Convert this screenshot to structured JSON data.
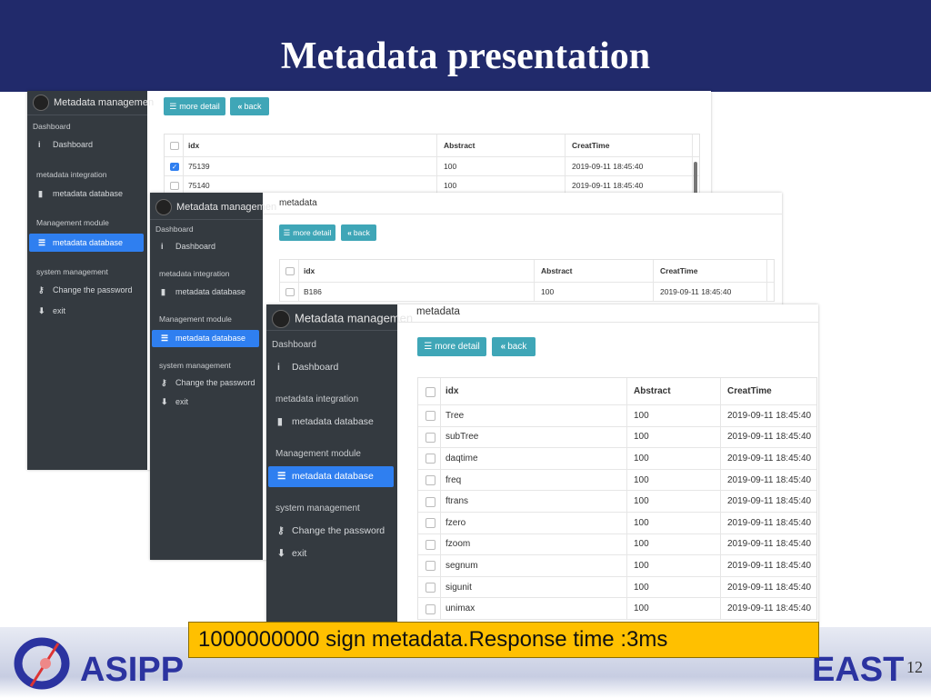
{
  "slide": {
    "title": "Metadata presentation",
    "banner": "1000000000 sign metadata.Response time :3ms",
    "logo_left": "ASIPP",
    "logo_right": "EAST",
    "page_number": "12"
  },
  "colors": {
    "header": "#212a6b",
    "sidebar": "#343a40",
    "active": "#2f7ff0",
    "button": "#3fa6b7",
    "banner": "#ffc000"
  },
  "sidebar": {
    "brand": "Metadata managemen",
    "items": [
      {
        "type": "group",
        "label": "Dashboard"
      },
      {
        "type": "item",
        "icon": "info-icon",
        "label": "Dashboard"
      },
      {
        "type": "group",
        "label": "metadata integration"
      },
      {
        "type": "item",
        "icon": "file-icon",
        "label": "metadata database"
      },
      {
        "type": "group",
        "label": "Management module"
      },
      {
        "type": "item",
        "icon": "list-icon",
        "label": "metadata database",
        "active": true
      },
      {
        "type": "group",
        "label": "system management"
      },
      {
        "type": "item",
        "icon": "key-icon",
        "label": "Change the password"
      },
      {
        "type": "item",
        "icon": "arrow-down-icon",
        "label": "exit"
      }
    ]
  },
  "main": {
    "page_title": "metadata",
    "more_detail": "more detail",
    "back": "back",
    "columns": [
      "idx",
      "Abstract",
      "CreatTime"
    ]
  },
  "panels": [
    {
      "rows": [
        {
          "idx": "75139",
          "abstract": "100",
          "time": "2019-09-11 18:45:40",
          "checked": true
        },
        {
          "idx": "75140",
          "abstract": "100",
          "time": "2019-09-11 18:45:40",
          "checked": false
        }
      ]
    },
    {
      "rows": [
        {
          "idx": "B186",
          "abstract": "100",
          "time": "2019-09-11 18:45:40",
          "checked": false
        }
      ]
    },
    {
      "rows": [
        {
          "idx": "Tree",
          "abstract": "100",
          "time": "2019-09-11 18:45:40",
          "checked": false
        },
        {
          "idx": "subTree",
          "abstract": "100",
          "time": "2019-09-11 18:45:40",
          "checked": false
        },
        {
          "idx": "daqtime",
          "abstract": "100",
          "time": "2019-09-11 18:45:40",
          "checked": false
        },
        {
          "idx": "freq",
          "abstract": "100",
          "time": "2019-09-11 18:45:40",
          "checked": false
        },
        {
          "idx": "ftrans",
          "abstract": "100",
          "time": "2019-09-11 18:45:40",
          "checked": false
        },
        {
          "idx": "fzero",
          "abstract": "100",
          "time": "2019-09-11 18:45:40",
          "checked": false
        },
        {
          "idx": "fzoom",
          "abstract": "100",
          "time": "2019-09-11 18:45:40",
          "checked": false
        },
        {
          "idx": "segnum",
          "abstract": "100",
          "time": "2019-09-11 18:45:40",
          "checked": false
        },
        {
          "idx": "sigunit",
          "abstract": "100",
          "time": "2019-09-11 18:45:40",
          "checked": false
        },
        {
          "idx": "unimax",
          "abstract": "100",
          "time": "2019-09-11 18:45:40",
          "checked": false
        }
      ]
    }
  ]
}
